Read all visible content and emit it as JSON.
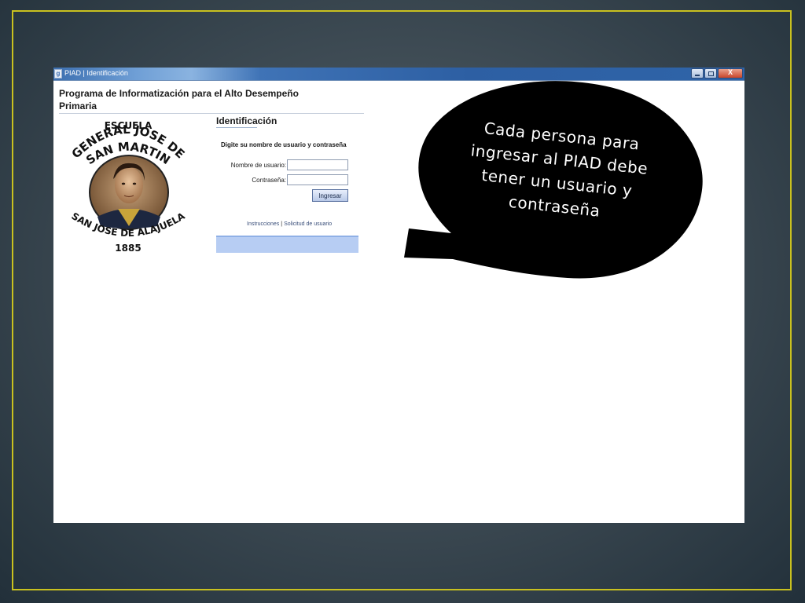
{
  "window": {
    "title": "PIAD | Identificación",
    "icon_name": "app-icon",
    "controls": [
      "minimize-icon",
      "maximize-icon",
      "close-icon"
    ],
    "close_glyph": "X"
  },
  "app": {
    "title": "Programa de Informatización para el Alto Desempeño Primaria"
  },
  "logo": {
    "line1": "ESCUELA",
    "line2": "GENERAL JOSE DE",
    "line3": "SAN MARTIN",
    "line4": "SAN JOSE DE ALAJUELA",
    "line5": "1885"
  },
  "login": {
    "title": "Identificación",
    "instruction": "Digite su nombre de usuario y contraseña",
    "username_label": "Nombre de usuario:",
    "username_value": "",
    "password_label": "Contraseña:",
    "password_value": "",
    "submit_label": "Ingresar"
  },
  "links": {
    "instructions": "Instrucciones",
    "separator": "|",
    "request": "Solicitud de usuario"
  },
  "callout": {
    "text": "Cada persona para ingresar al PIAD debe tener un usuario y contraseña"
  },
  "colors": {
    "slide_border": "#c9c11f",
    "callout_fill": "#000000",
    "titlebar": "#2f64a8",
    "login_panel": "#b7cdf3"
  }
}
